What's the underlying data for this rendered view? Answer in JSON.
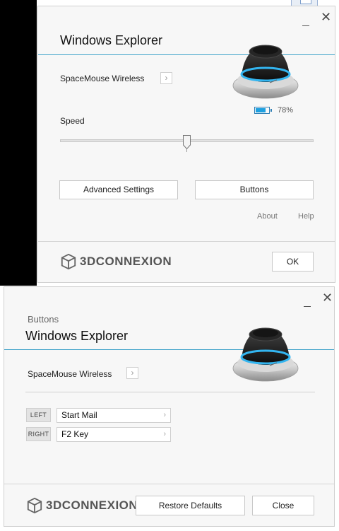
{
  "window1": {
    "title": "Windows Explorer",
    "device_label": "SpaceMouse Wireless",
    "chevron": "›",
    "battery_percent": "78%",
    "battery_level": 0.78,
    "speed_label": "Speed",
    "speed_level": 0.5,
    "advanced_settings_label": "Advanced Settings",
    "buttons_label": "Buttons",
    "about_label": "About",
    "help_label": "Help",
    "ok_label": "OK",
    "brand": "3DCONNEXION"
  },
  "window2": {
    "caption": "Buttons",
    "title": "Windows Explorer",
    "device_label": "SpaceMouse Wireless",
    "chevron": "›",
    "assignments": [
      {
        "side": "LEFT",
        "action": "Start Mail"
      },
      {
        "side": "RIGHT",
        "action": "F2 Key"
      }
    ],
    "restore_defaults_label": "Restore Defaults",
    "close_label": "Close",
    "brand": "3DCONNEXION"
  },
  "window_controls": {
    "minimize": "–",
    "close": "✕"
  },
  "colors": {
    "accent": "#3aa0c8",
    "battery": "#1ea0e0",
    "puck_ring": "#33b5f0"
  },
  "icons": [
    "minimize-icon",
    "close-icon",
    "chevron-right-icon",
    "battery-icon",
    "spacemouse-device-icon",
    "3dconnexion-logo-icon"
  ]
}
